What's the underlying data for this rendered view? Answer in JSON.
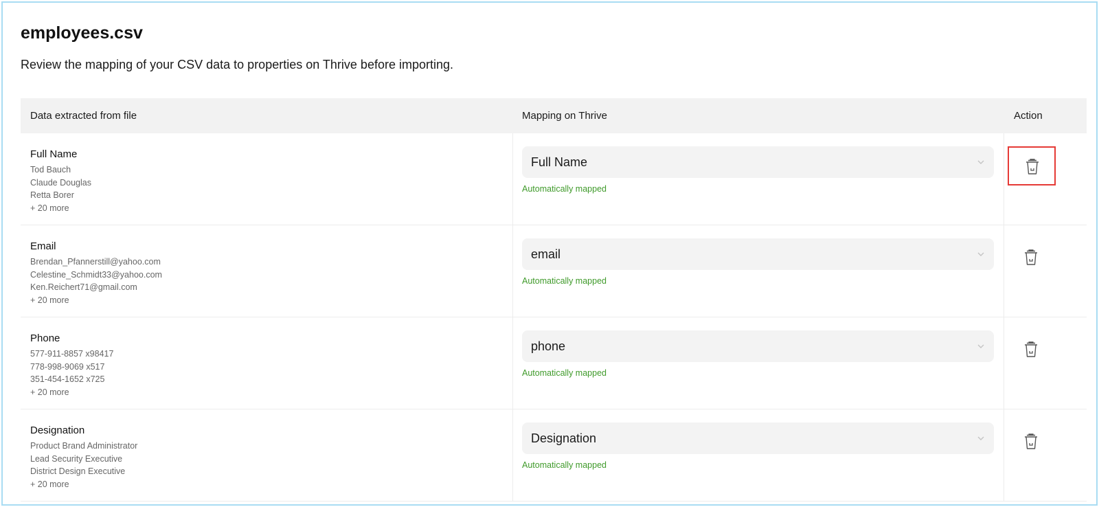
{
  "page": {
    "title": "employees.csv",
    "subtitle": "Review the mapping of your CSV data to properties on Thrive before importing."
  },
  "table": {
    "headers": {
      "data": "Data extracted from file",
      "mapping": "Mapping on Thrive",
      "action": "Action"
    },
    "rows": [
      {
        "field": "Full Name",
        "samples": [
          "Tod Bauch",
          "Claude Douglas",
          "Retta Borer"
        ],
        "more": "+ 20 more",
        "mapping": "Full Name",
        "status": "Automatically mapped"
      },
      {
        "field": "Email",
        "samples": [
          "Brendan_Pfannerstill@yahoo.com",
          "Celestine_Schmidt33@yahoo.com",
          "Ken.Reichert71@gmail.com"
        ],
        "more": "+ 20 more",
        "mapping": "email",
        "status": "Automatically mapped"
      },
      {
        "field": "Phone",
        "samples": [
          "577-911-8857 x98417",
          "778-998-9069 x517",
          "351-454-1652 x725"
        ],
        "more": "+ 20 more",
        "mapping": "phone",
        "status": "Automatically mapped"
      },
      {
        "field": "Designation",
        "samples": [
          "Product Brand Administrator",
          "Lead Security Executive",
          "District Design Executive"
        ],
        "more": "+ 20 more",
        "mapping": "Designation",
        "status": "Automatically mapped"
      }
    ]
  },
  "colors": {
    "status_green": "#3f9a2a",
    "highlight_red": "#e53935",
    "frame_blue": "#a9dcf3"
  },
  "icons": {
    "delete": "trash-icon",
    "dropdown": "chevron-down-icon"
  }
}
